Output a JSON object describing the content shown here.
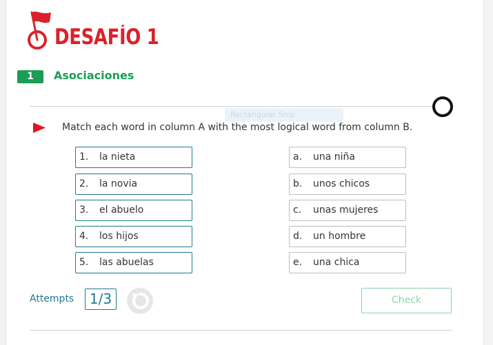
{
  "header": {
    "title": "DESAFÍO 1"
  },
  "section": {
    "number": "1",
    "title": "Asociaciones"
  },
  "overlay": {
    "snip_label": "Rectangular Snip"
  },
  "instruction": "Match each word in column A with the most logical word from column B.",
  "column_a": [
    {
      "label": "1.",
      "text": "la nieta"
    },
    {
      "label": "2.",
      "text": "la novia"
    },
    {
      "label": "3.",
      "text": "el abuelo"
    },
    {
      "label": "4.",
      "text": "los hijos"
    },
    {
      "label": "5.",
      "text": "las abuelas"
    }
  ],
  "column_b": [
    {
      "label": "a.",
      "text": "una niña"
    },
    {
      "label": "b.",
      "text": "unos chicos"
    },
    {
      "label": "c.",
      "text": "unas mujeres"
    },
    {
      "label": "d.",
      "text": "un hombre"
    },
    {
      "label": "e.",
      "text": "una chica"
    }
  ],
  "footer": {
    "attempts_label": "Attempts",
    "attempts_value": "1/3",
    "check_label": "Check"
  },
  "colors": {
    "title_red": "#d9232a",
    "accent_green": "#1a9d55",
    "teal": "#1a7a8e"
  },
  "icons": [
    "flag-icon",
    "play-icon",
    "ring-icon",
    "retry-icon"
  ]
}
